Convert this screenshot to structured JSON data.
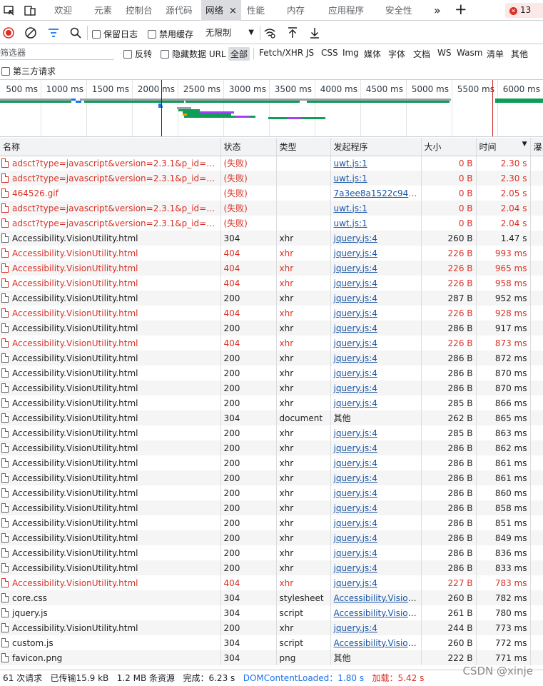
{
  "tabs": {
    "items": [
      "欢迎",
      "元素",
      "控制台",
      "源代码",
      "网络",
      "性能",
      "内存",
      "应用程序",
      "安全性"
    ],
    "active": "网络",
    "close": "×",
    "more": "»",
    "new_tab": "+",
    "issues_count": "13"
  },
  "toolbar": {
    "preserve_log": "保留日志",
    "disable_cache": "禁用缓存",
    "throttle": "无限制"
  },
  "filter": {
    "placeholder": "筛选器",
    "invert": "反转",
    "hide_data_urls": "隐藏数据 URL",
    "types": [
      "全部",
      "Fetch/XHR",
      "JS",
      "CSS",
      "Img",
      "媒体",
      "字体",
      "文档",
      "WS",
      "Wasm",
      "清单",
      "其他"
    ],
    "active_type": "全部",
    "third_party": "第三方请求"
  },
  "overview": {
    "ticks": [
      "500 ms",
      "1000 ms",
      "1500 ms",
      "2000 ms",
      "2500 ms",
      "3000 ms",
      "3500 ms",
      "4000 ms",
      "4500 ms",
      "5000 ms",
      "5500 ms",
      "6000 ms"
    ],
    "dom_content_loaded_color": "#1a1aa6",
    "load_color": "#c5221f"
  },
  "table": {
    "headers": [
      "名称",
      "状态",
      "类型",
      "发起程序",
      "大小",
      "时间",
      "瀑"
    ],
    "sort_indicator": "▼",
    "rows": [
      {
        "name": "adsct?type=javascript&version=2.3.1&p_id=Twitter&p_user_id=0&txn_id=o8h0b",
        "status": "(失败)",
        "type": "",
        "initiator": "uwt.js:1",
        "link": true,
        "size": "0 B",
        "time": "2.30 s",
        "error": true
      },
      {
        "name": "adsct?type=javascript&version=2.3.1&p_id=Twitter&p_user_id=0&txn_id=o8h0b",
        "status": "(失败)",
        "type": "",
        "initiator": "uwt.js:1",
        "link": true,
        "size": "0 B",
        "time": "2.30 s",
        "error": true
      },
      {
        "name": "464526.gif",
        "status": "(失败)",
        "type": "",
        "initiator": "7a3ee8a1522c9470.js",
        "link": true,
        "size": "0 B",
        "time": "2.05 s",
        "error": true
      },
      {
        "name": "adsct?type=javascript&version=2.3.1&p_id=Twitter&p_user_id=0&txn_id=o8h0b",
        "status": "(失败)",
        "type": "",
        "initiator": "uwt.js:1",
        "link": true,
        "size": "0 B",
        "time": "2.04 s",
        "error": true
      },
      {
        "name": "adsct?type=javascript&version=2.3.1&p_id=Twitter&p_user_id=0&txn_id=o8h0b",
        "status": "(失败)",
        "type": "",
        "initiator": "uwt.js:1",
        "link": true,
        "size": "0 B",
        "time": "2.04 s",
        "error": true
      },
      {
        "name": "Accessibility.VisionUtility.html",
        "status": "304",
        "type": "xhr",
        "initiator": "jquery.js:4",
        "link": true,
        "size": "260 B",
        "time": "1.47 s",
        "error": false
      },
      {
        "name": "Accessibility.VisionUtility.html",
        "status": "404",
        "type": "xhr",
        "initiator": "jquery.js:4",
        "link": true,
        "size": "226 B",
        "time": "993 ms",
        "error": true
      },
      {
        "name": "Accessibility.VisionUtility.html",
        "status": "404",
        "type": "xhr",
        "initiator": "jquery.js:4",
        "link": true,
        "size": "226 B",
        "time": "965 ms",
        "error": true
      },
      {
        "name": "Accessibility.VisionUtility.html",
        "status": "404",
        "type": "xhr",
        "initiator": "jquery.js:4",
        "link": true,
        "size": "226 B",
        "time": "958 ms",
        "error": true
      },
      {
        "name": "Accessibility.VisionUtility.html",
        "status": "200",
        "type": "xhr",
        "initiator": "jquery.js:4",
        "link": true,
        "size": "287 B",
        "time": "952 ms",
        "error": false
      },
      {
        "name": "Accessibility.VisionUtility.html",
        "status": "404",
        "type": "xhr",
        "initiator": "jquery.js:4",
        "link": true,
        "size": "226 B",
        "time": "928 ms",
        "error": true
      },
      {
        "name": "Accessibility.VisionUtility.html",
        "status": "200",
        "type": "xhr",
        "initiator": "jquery.js:4",
        "link": true,
        "size": "286 B",
        "time": "917 ms",
        "error": false
      },
      {
        "name": "Accessibility.VisionUtility.html",
        "status": "404",
        "type": "xhr",
        "initiator": "jquery.js:4",
        "link": true,
        "size": "226 B",
        "time": "873 ms",
        "error": true
      },
      {
        "name": "Accessibility.VisionUtility.html",
        "status": "200",
        "type": "xhr",
        "initiator": "jquery.js:4",
        "link": true,
        "size": "286 B",
        "time": "872 ms",
        "error": false
      },
      {
        "name": "Accessibility.VisionUtility.html",
        "status": "200",
        "type": "xhr",
        "initiator": "jquery.js:4",
        "link": true,
        "size": "286 B",
        "time": "870 ms",
        "error": false
      },
      {
        "name": "Accessibility.VisionUtility.html",
        "status": "200",
        "type": "xhr",
        "initiator": "jquery.js:4",
        "link": true,
        "size": "286 B",
        "time": "870 ms",
        "error": false
      },
      {
        "name": "Accessibility.VisionUtility.html",
        "status": "200",
        "type": "xhr",
        "initiator": "jquery.js:4",
        "link": true,
        "size": "285 B",
        "time": "866 ms",
        "error": false
      },
      {
        "name": "Accessibility.VisionUtility.html",
        "status": "304",
        "type": "document",
        "initiator": "其他",
        "link": false,
        "size": "262 B",
        "time": "865 ms",
        "error": false
      },
      {
        "name": "Accessibility.VisionUtility.html",
        "status": "200",
        "type": "xhr",
        "initiator": "jquery.js:4",
        "link": true,
        "size": "285 B",
        "time": "863 ms",
        "error": false
      },
      {
        "name": "Accessibility.VisionUtility.html",
        "status": "200",
        "type": "xhr",
        "initiator": "jquery.js:4",
        "link": true,
        "size": "286 B",
        "time": "862 ms",
        "error": false
      },
      {
        "name": "Accessibility.VisionUtility.html",
        "status": "200",
        "type": "xhr",
        "initiator": "jquery.js:4",
        "link": true,
        "size": "286 B",
        "time": "861 ms",
        "error": false
      },
      {
        "name": "Accessibility.VisionUtility.html",
        "status": "200",
        "type": "xhr",
        "initiator": "jquery.js:4",
        "link": true,
        "size": "286 B",
        "time": "861 ms",
        "error": false
      },
      {
        "name": "Accessibility.VisionUtility.html",
        "status": "200",
        "type": "xhr",
        "initiator": "jquery.js:4",
        "link": true,
        "size": "286 B",
        "time": "860 ms",
        "error": false
      },
      {
        "name": "Accessibility.VisionUtility.html",
        "status": "200",
        "type": "xhr",
        "initiator": "jquery.js:4",
        "link": true,
        "size": "286 B",
        "time": "858 ms",
        "error": false
      },
      {
        "name": "Accessibility.VisionUtility.html",
        "status": "200",
        "type": "xhr",
        "initiator": "jquery.js:4",
        "link": true,
        "size": "286 B",
        "time": "851 ms",
        "error": false
      },
      {
        "name": "Accessibility.VisionUtility.html",
        "status": "200",
        "type": "xhr",
        "initiator": "jquery.js:4",
        "link": true,
        "size": "286 B",
        "time": "849 ms",
        "error": false
      },
      {
        "name": "Accessibility.VisionUtility.html",
        "status": "200",
        "type": "xhr",
        "initiator": "jquery.js:4",
        "link": true,
        "size": "286 B",
        "time": "836 ms",
        "error": false
      },
      {
        "name": "Accessibility.VisionUtility.html",
        "status": "200",
        "type": "xhr",
        "initiator": "jquery.js:4",
        "link": true,
        "size": "286 B",
        "time": "833 ms",
        "error": false
      },
      {
        "name": "Accessibility.VisionUtility.html",
        "status": "404",
        "type": "xhr",
        "initiator": "jquery.js:4",
        "link": true,
        "size": "227 B",
        "time": "783 ms",
        "error": true
      },
      {
        "name": "core.css",
        "status": "304",
        "type": "stylesheet",
        "initiator": "Accessibility.VisionUtility.html",
        "link": true,
        "size": "260 B",
        "time": "782 ms",
        "error": false
      },
      {
        "name": "jquery.js",
        "status": "304",
        "type": "script",
        "initiator": "Accessibility.VisionUtility.html",
        "link": true,
        "size": "261 B",
        "time": "780 ms",
        "error": false
      },
      {
        "name": "Accessibility.VisionUtility.html",
        "status": "200",
        "type": "xhr",
        "initiator": "jquery.js:4",
        "link": true,
        "size": "244 B",
        "time": "773 ms",
        "error": false
      },
      {
        "name": "custom.js",
        "status": "304",
        "type": "script",
        "initiator": "Accessibility.VisionUtility.html",
        "link": true,
        "size": "260 B",
        "time": "772 ms",
        "error": false
      },
      {
        "name": "favicon.png",
        "status": "304",
        "type": "png",
        "initiator": "其他",
        "link": false,
        "size": "222 B",
        "time": "771 ms",
        "error": false
      }
    ]
  },
  "status": {
    "requests": "61 次请求",
    "transferred": "已传输15.9 kB",
    "resources": "1.2 MB 条资源",
    "finish": "完成：6.23 s",
    "dcl": "DOMContentLoaded：1.80 s",
    "load": "加载：5.42 s"
  },
  "watermark": "CSDN @xinje"
}
